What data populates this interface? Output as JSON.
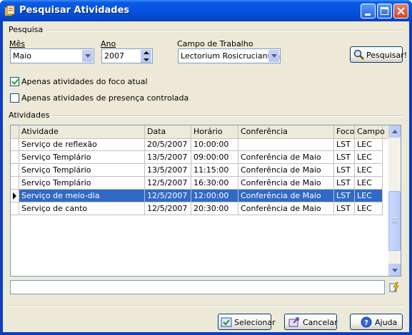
{
  "window": {
    "title": "Pesquisar Atividades"
  },
  "search_group": {
    "title": "Pesquisa",
    "month": {
      "label": "Mês",
      "value": "Maio"
    },
    "year": {
      "label": "Ano",
      "value": "2007"
    },
    "field": {
      "label": "Campo de Trabalho",
      "value": "Lectorium Rosicrucianum"
    },
    "search_button": "Pesquisar!",
    "only_current_focus": {
      "label": "Apenas atividades do foco atual",
      "checked": true
    },
    "only_controlled": {
      "label": "Apenas atividades de presença controlada",
      "checked": false
    }
  },
  "activities_group": {
    "title": "Atividades",
    "columns": [
      "Atividade",
      "Data",
      "Horário",
      "Conferência",
      "Foco",
      "Campo"
    ],
    "rows": [
      {
        "atividade": "Serviço de reflexão",
        "data": "20/5/2007",
        "horario": "10:00:00",
        "conferencia": "",
        "foco": "LST",
        "campo": "LEC"
      },
      {
        "atividade": "Serviço Templário",
        "data": "13/5/2007",
        "horario": "09:00:00",
        "conferencia": "Conferência de Maio",
        "foco": "LST",
        "campo": "LEC"
      },
      {
        "atividade": "Serviço Templário",
        "data": "13/5/2007",
        "horario": "11:15:00",
        "conferencia": "Conferência de Maio",
        "foco": "LST",
        "campo": "LEC"
      },
      {
        "atividade": "Serviço Templário",
        "data": "12/5/2007",
        "horario": "16:30:00",
        "conferencia": "Conferência de Maio",
        "foco": "LST",
        "campo": "LEC"
      },
      {
        "atividade": "Serviço de meio-dia",
        "data": "12/5/2007",
        "horario": "12:00:00",
        "conferencia": "Conferência de Maio",
        "foco": "LST",
        "campo": "LEC"
      },
      {
        "atividade": "Serviço de canto",
        "data": "12/5/2007",
        "horario": "20:30:00",
        "conferencia": "Conferência de Maio",
        "foco": "LST",
        "campo": "LEC"
      }
    ],
    "selected_index": 4,
    "filter_value": ""
  },
  "footer": {
    "select_button": "Selecionar",
    "cancel_button": "Cancelar",
    "help_button": "Ajuda"
  },
  "colors": {
    "titlebar": "#0553e0",
    "selection": "#316ac5",
    "dialog": "#ece9d8"
  }
}
